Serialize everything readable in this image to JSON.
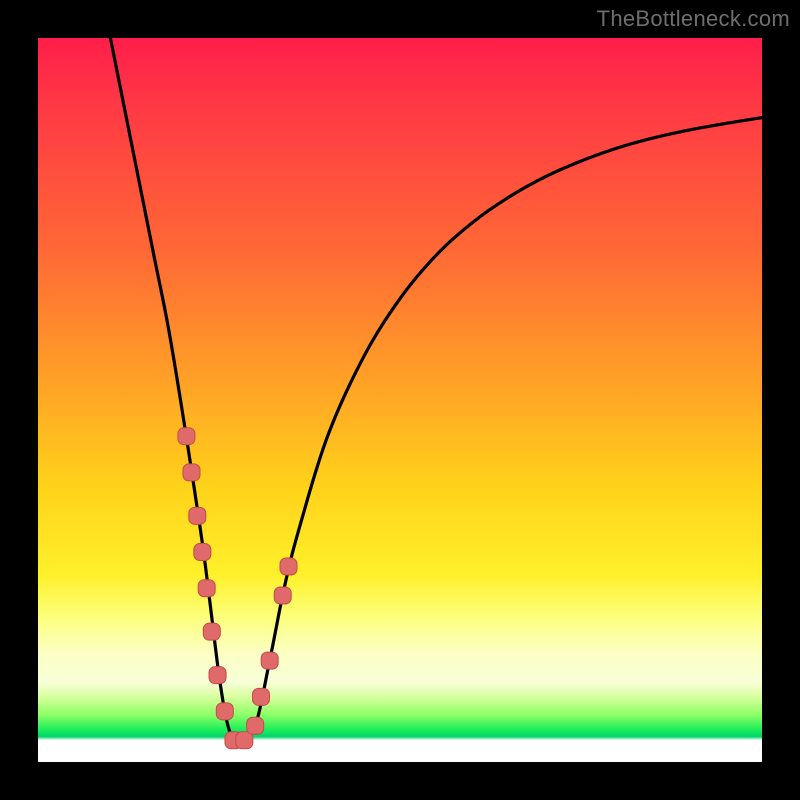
{
  "watermark": "TheBottleneck.com",
  "colors": {
    "curve": "#000000",
    "marker_fill": "#e06a6a",
    "marker_stroke": "#c24a4a"
  },
  "chart_data": {
    "type": "line",
    "title": "",
    "xlabel": "",
    "ylabel": "",
    "xlim": [
      0,
      100
    ],
    "ylim": [
      0,
      100
    ],
    "curve": {
      "name": "bottleneck-curve",
      "x": [
        10,
        12,
        14,
        16,
        18,
        20,
        22,
        23,
        24,
        25,
        26,
        27,
        28,
        30,
        32,
        34,
        36,
        40,
        45,
        50,
        55,
        60,
        65,
        70,
        75,
        80,
        85,
        90,
        95,
        100
      ],
      "y": [
        100,
        90,
        80,
        70,
        60,
        48,
        35,
        28,
        20,
        12,
        6,
        3,
        3,
        5,
        14,
        24,
        32,
        45,
        56,
        64,
        70,
        74.5,
        78,
        80.8,
        83,
        84.8,
        86.2,
        87.3,
        88.2,
        89
      ]
    },
    "markers": {
      "name": "sample-points",
      "x": [
        20.5,
        21.2,
        22.0,
        22.7,
        23.3,
        24.0,
        24.8,
        25.8,
        27.0,
        28.5,
        30.0,
        30.8,
        32.0,
        33.8,
        34.6
      ],
      "y": [
        45,
        40,
        34,
        29,
        24,
        18,
        12,
        7,
        3,
        3,
        5,
        9,
        14,
        23,
        27
      ]
    }
  }
}
